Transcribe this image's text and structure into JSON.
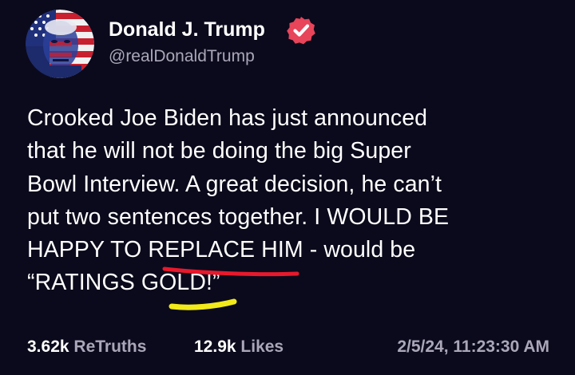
{
  "post": {
    "author": {
      "display_name": "Donald J. Trump",
      "handle": "@realDonaldTrump",
      "verified_icon": "verified-badge-icon",
      "avatar_icon": "flag-portrait-avatar"
    },
    "body_lines": [
      "Crooked Joe Biden has just announced",
      "that he will not be doing the big Super",
      "Bowl Interview. A great decision, he can’t",
      "put two sentences together. I WOULD BE",
      "HAPPY TO REPLACE HIM - would be",
      "“RATINGS GOLD!”"
    ],
    "stats": {
      "retruths_count": "3.62k",
      "retruths_label": "ReTruths",
      "likes_count": "12.9k",
      "likes_label": "Likes"
    },
    "timestamp": "2/5/24, 11:23:30 AM"
  },
  "colors": {
    "background": "#0b0a1c",
    "text": "#ffffff",
    "muted": "#a9a7b8",
    "verified_badge": "#e8445a",
    "underline_red": "#e8192c",
    "underline_yellow": "#f2ea1a"
  }
}
